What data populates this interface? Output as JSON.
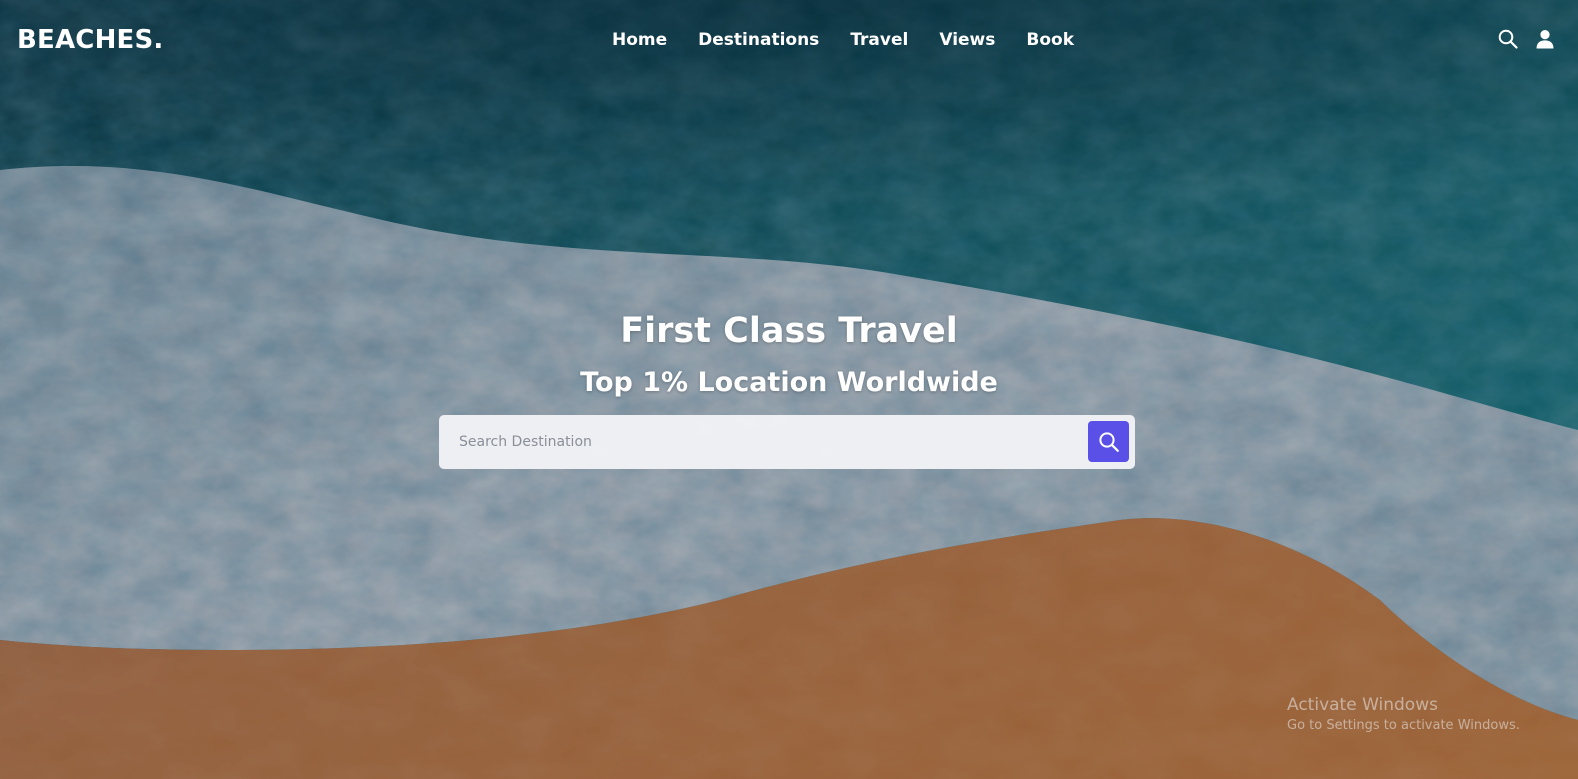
{
  "brand": {
    "logo": "BEACHES."
  },
  "nav": {
    "items": [
      {
        "label": "Home"
      },
      {
        "label": "Destinations"
      },
      {
        "label": "Travel"
      },
      {
        "label": "Views"
      },
      {
        "label": "Book"
      }
    ]
  },
  "header_icons": {
    "search": "search-icon",
    "user": "user-icon"
  },
  "hero": {
    "title": "First Class Travel",
    "subtitle": "Top 1% Location Worldwide",
    "search": {
      "placeholder": "Search Destination",
      "button_icon": "search-icon"
    }
  },
  "watermark": {
    "title": "Activate Windows",
    "subtitle": "Go to Settings to activate Windows."
  },
  "colors": {
    "accent": "#5a4fe6",
    "text": "#ffffff",
    "search_bg": "#f1f3f6",
    "ocean_deep": "#0d4a5a",
    "ocean_teal": "#177d88",
    "foam": "#b9c6d2",
    "sand": "#b8764a"
  }
}
